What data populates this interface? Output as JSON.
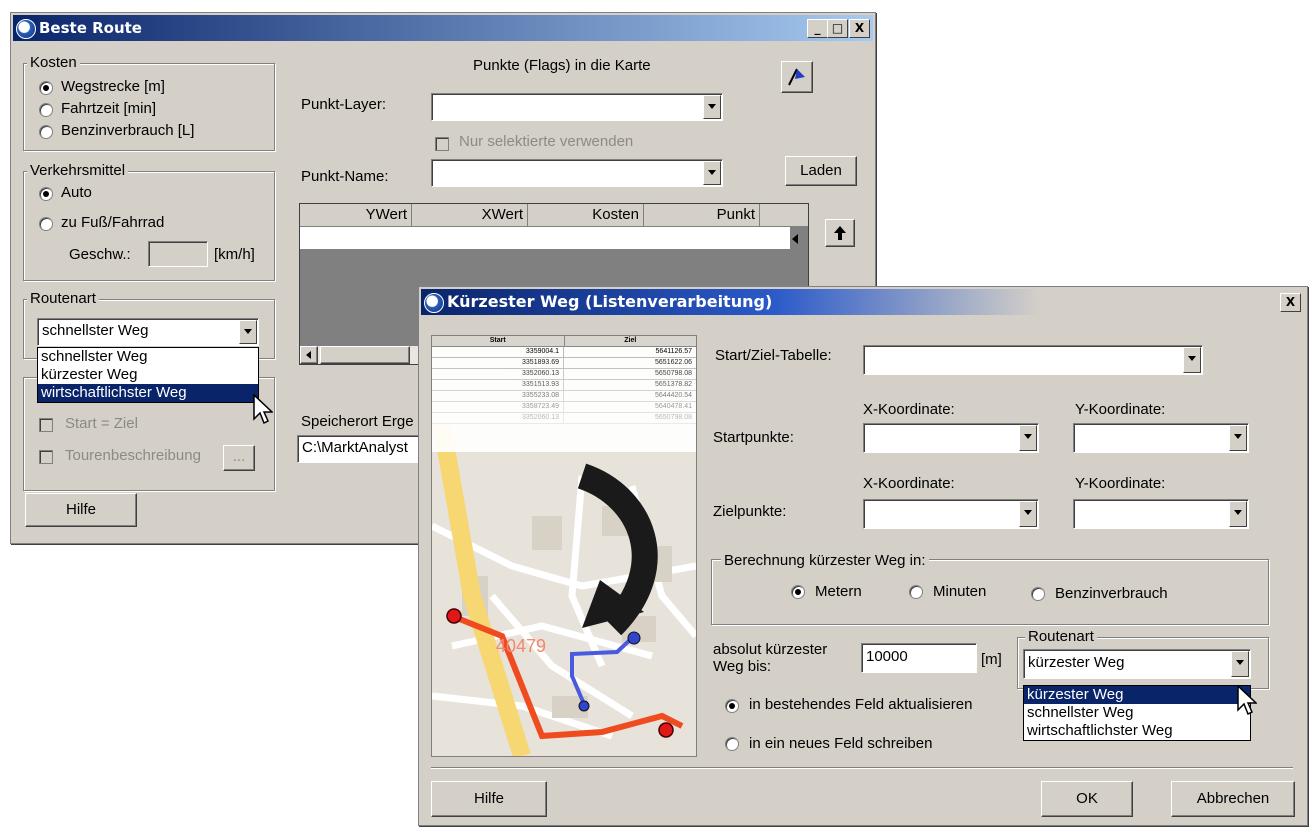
{
  "window1": {
    "title": "Beste Route",
    "controls": {
      "minimize": "_",
      "maximize": "□",
      "close": "X"
    },
    "kosten": {
      "label": "Kosten",
      "options": [
        "Wegstrecke [m]",
        "Fahrtzeit [min]",
        "Benzinverbrauch [L]"
      ],
      "selected": "Wegstrecke [m]"
    },
    "verkehrsmittel": {
      "label": "Verkehrsmittel",
      "options": [
        "Auto",
        "zu Fuß/Fahrrad"
      ],
      "selected": "Auto",
      "speed_label": "Geschw.:",
      "speed_value": "",
      "speed_unit": "[km/h]"
    },
    "routenart": {
      "label": "Routenart",
      "value": "schnellster Weg",
      "dropdown_options": [
        "schnellster Weg",
        "kürzester Weg",
        "wirtschaftlichster Weg"
      ],
      "highlighted": "wirtschaftlichster Weg"
    },
    "start_ziel": "Start = Ziel",
    "tourenbeschreibung": "Tourenbeschreibung",
    "tour_btn": "...",
    "hilfe": "Hilfe",
    "points_heading": "Punkte (Flags) in die Karte",
    "punkt_layer_label": "Punkt-Layer:",
    "punkt_layer_value": "",
    "nur_selektierte": "Nur selektierte verwenden",
    "punkt_name_label": "Punkt-Name:",
    "punkt_name_value": "",
    "laden": "Laden",
    "table_headers": [
      "YWert",
      "XWert",
      "Kosten",
      "Punkt"
    ],
    "speicherort_label": "Speicherort Erge",
    "speicherort_value": "C:\\MarktAnalyst"
  },
  "window2": {
    "title": "Kürzester Weg (Listenverarbeitung)",
    "close": "X",
    "preview": {
      "headers": [
        "Start",
        "Ziel"
      ],
      "rows": [
        [
          "3359004.1",
          "5641126.57"
        ],
        [
          "3351893.69",
          "5651622.06"
        ],
        [
          "3352060.13",
          "5650798.08"
        ],
        [
          "3351513.93",
          "5651378.82"
        ],
        [
          "3355233.08",
          "5644420.54"
        ],
        [
          "3358723.49",
          "5640478.41"
        ],
        [
          "3352060.13",
          "5650798.08"
        ]
      ],
      "map_label": "40479"
    },
    "tabelle_label": "Start/Ziel-Tabelle:",
    "tabelle_value": "",
    "x_label": "X-Koordinate:",
    "y_label": "Y-Koordinate:",
    "startpunkte": "Startpunkte:",
    "zielpunkte": "Zielpunkte:",
    "berechnung": {
      "label": "Berechnung  kürzester Weg in:",
      "options": [
        "Metern",
        "Minuten",
        "Benzinverbrauch"
      ],
      "selected": "Metern"
    },
    "absolut_label": "absolut kürzester Weg bis:",
    "absolut_value": "10000",
    "absolut_unit": "[m]",
    "routenart": {
      "label": "Routenart",
      "value": "kürzester Weg",
      "dropdown_options": [
        "kürzester Weg",
        "schnellster Weg",
        "wirtschaftlichster Weg"
      ],
      "highlighted": "kürzester Weg"
    },
    "feld_options": [
      "in bestehendes Feld aktualisieren",
      "in ein neues Feld schreiben"
    ],
    "feld_selected": "in bestehendes Feld aktualisieren",
    "hilfe": "Hilfe",
    "ok": "OK",
    "abbrechen": "Abbrechen"
  }
}
